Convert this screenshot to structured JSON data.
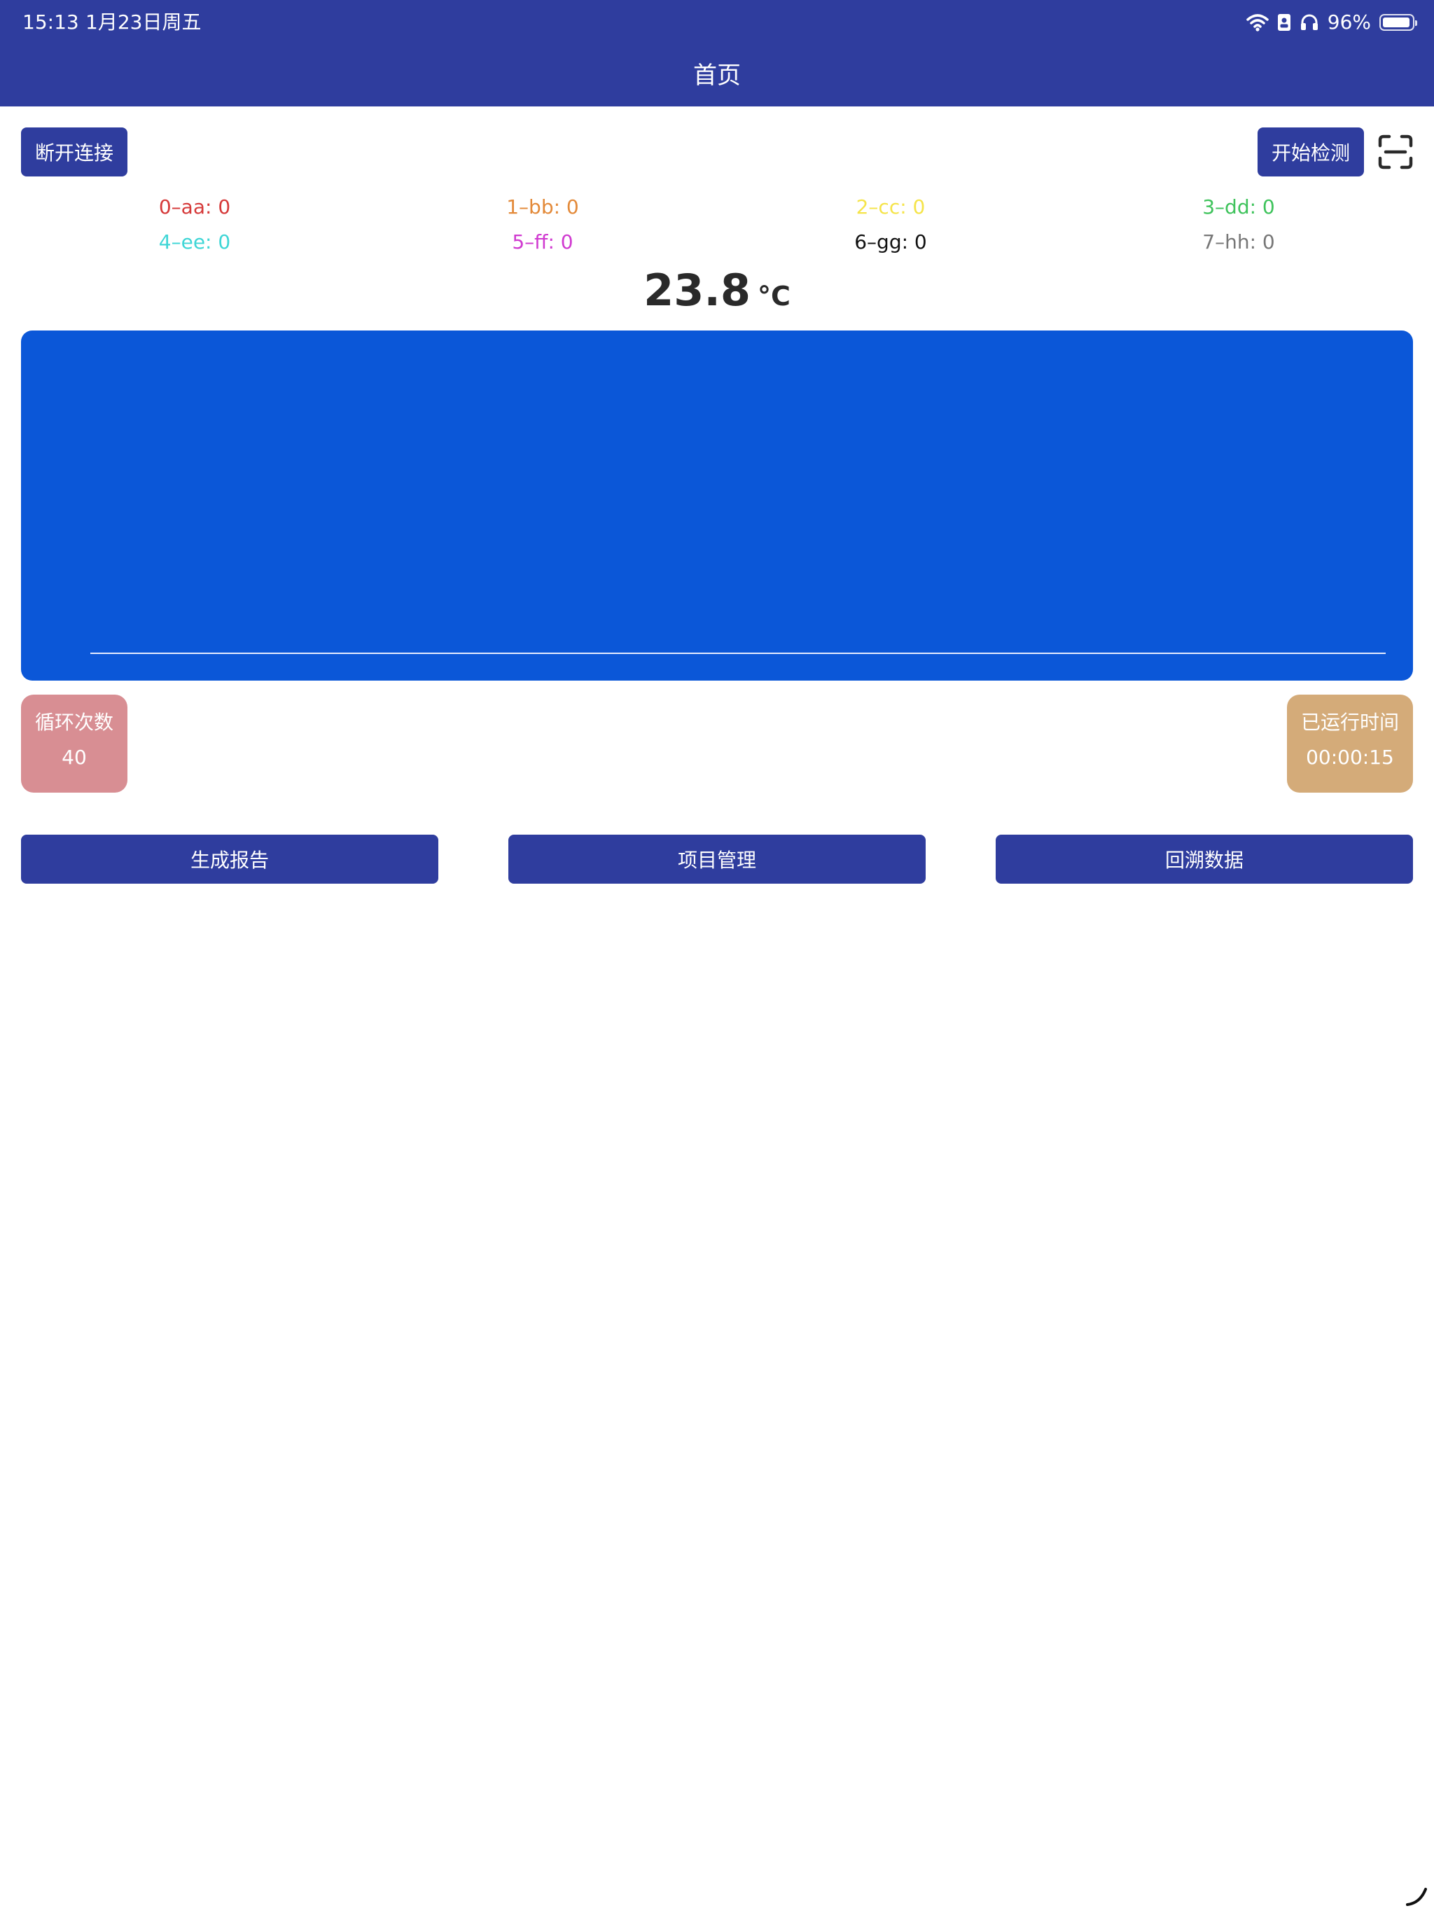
{
  "status_bar": {
    "time": "15:13",
    "date": "1月23日周五",
    "battery_text": "96%",
    "battery_level": 0.96
  },
  "header": {
    "title": "首页"
  },
  "toolbar": {
    "disconnect_label": "断开连接",
    "start_label": "开始检测",
    "scan_icon": "scan-icon"
  },
  "legend": [
    {
      "text": "0–aa: 0",
      "color": "#d63a3a"
    },
    {
      "text": "1–bb: 0",
      "color": "#e38a3a"
    },
    {
      "text": "2–cc: 0",
      "color": "#f5e44a"
    },
    {
      "text": "3–dd: 0",
      "color": "#3fc35c"
    },
    {
      "text": "4–ee: 0",
      "color": "#3fd6d6"
    },
    {
      "text": "5–ff: 0",
      "color": "#d03ad0"
    },
    {
      "text": "6–gg: 0",
      "color": "#111111"
    },
    {
      "text": "7–hh: 0",
      "color": "#777777"
    }
  ],
  "temperature": {
    "value": "23.8",
    "unit": "°C"
  },
  "chart": {
    "background": "#0b57d8",
    "axis_color": "#e6ecff"
  },
  "cards": {
    "cycles": {
      "label": "循环次数",
      "value": "40",
      "color": "#d88e93"
    },
    "runtime": {
      "label": "已运行时间",
      "value": "00:00:15",
      "color": "#d4ab79"
    }
  },
  "actions": {
    "report_label": "生成报告",
    "project_label": "项目管理",
    "trace_label": "回溯数据"
  },
  "colors": {
    "primary": "#2f3d9e"
  }
}
